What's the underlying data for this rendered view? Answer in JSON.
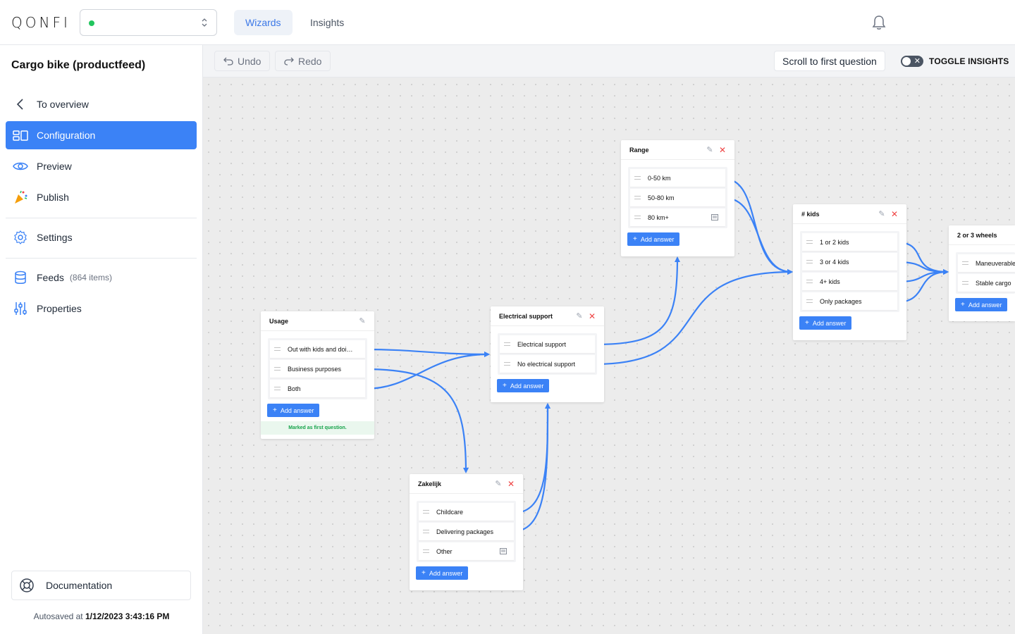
{
  "topbar": {
    "logo": "QONFI",
    "tabs": [
      {
        "label": "Wizards",
        "active": true
      },
      {
        "label": "Insights",
        "active": false
      }
    ],
    "status_color": "#22c55e"
  },
  "sidebar": {
    "project_title": "Cargo bike (productfeed)",
    "items": [
      {
        "label": "To overview",
        "icon": "chevron-left-icon"
      },
      {
        "label": "Configuration",
        "icon": "layout-icon",
        "active": true
      },
      {
        "label": "Preview",
        "icon": "eye-icon"
      },
      {
        "label": "Publish",
        "icon": "party-popper-icon"
      },
      {
        "label": "Settings",
        "icon": "gear-icon"
      },
      {
        "label": "Feeds",
        "icon": "database-icon",
        "count": "(864 items)"
      },
      {
        "label": "Properties",
        "icon": "sliders-icon"
      }
    ],
    "documentation": "Documentation",
    "autosave_prefix": "Autosaved at",
    "autosave_time": "1/12/2023 3:43:16 PM"
  },
  "toolbar": {
    "undo": "Undo",
    "redo": "Redo",
    "scroll_first": "Scroll to first question",
    "toggle_insights": "TOGGLE INSIGHTS",
    "toggle_on": false
  },
  "accent_color": "#3b82f6",
  "nodes": {
    "usage": {
      "title": "Usage",
      "answers": [
        "Out with kids and doi…",
        "Business purposes",
        "Both"
      ],
      "add": "Add answer",
      "first_question": "Marked as first question."
    },
    "electrical": {
      "title": "Electrical support",
      "answers": [
        "Electrical support",
        "No electrical support"
      ],
      "add": "Add answer"
    },
    "range": {
      "title": "Range",
      "answers": [
        "0-50 km",
        "50-80 km",
        "80 km+"
      ],
      "add": "Add answer"
    },
    "kids": {
      "title": "# kids",
      "answers": [
        "1 or 2 kids",
        "3 or 4 kids",
        "4+ kids",
        "Only packages"
      ],
      "add": "Add answer"
    },
    "wheels": {
      "title": "2 or 3 wheels",
      "answers": [
        "Maneuverable",
        "Stable cargo"
      ],
      "add": "Add answer"
    },
    "zakelijk": {
      "title": "Zakelijk",
      "answers": [
        "Childcare",
        "Delivering packages",
        "Other"
      ],
      "add": "Add answer"
    }
  }
}
